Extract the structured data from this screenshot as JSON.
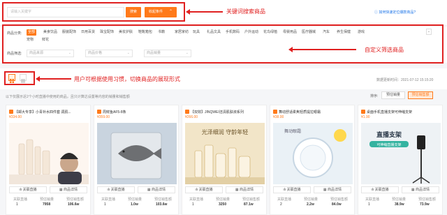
{
  "search": {
    "placeholder": "请输入关键字",
    "search_label": "搜索",
    "collapse_label": "收起条件",
    "help_link": "如何快速定位爆款商品?"
  },
  "annotations": {
    "search": "关键词搜索商品",
    "filter": "自定义筛选商品",
    "view": "用户可根据使用习惯，切换商品的展现形式"
  },
  "filters": {
    "category_label": "商品分类:",
    "categories": [
      "全部",
      "美食饮品",
      "服装配饰",
      "日用百货",
      "珠宝配饰",
      "美妆护肤",
      "鞋靴箱包",
      "书籍",
      "家居家纺",
      "玩具",
      "礼品文具",
      "手机数码",
      "户外运动",
      "花鸟绿植",
      "母婴用品",
      "医疗器械",
      "汽车",
      "养生保健",
      "游戏",
      "宠物",
      "鲜花"
    ],
    "sort_label": "商品筛选:",
    "selects": [
      "商品来源",
      "商品价格",
      "商品销量"
    ]
  },
  "view": {
    "timestamp": "数据更新时间：2021-07-12 15:15:20",
    "tip": "以下仅展示近2个小时直播中使用的商品，且只计算达设置等内容的销量和销售额",
    "sort_label": "排序:",
    "sort_options": [
      "预估销量",
      "预估销售额"
    ]
  },
  "products": [
    {
      "title": "【邮大专享】小青补水四件套 调肌...",
      "price": "¥334.00",
      "btn_live": "关联直播",
      "btn_detail": "商品详情",
      "live": "1",
      "sales": "7958",
      "revenue": "106.6w",
      "img_color": "#fdf6f0"
    },
    {
      "title": "周鲜鱼AF5-8条",
      "price": "¥359.00",
      "btn_live": "关联直播",
      "btn_detail": "商品详情",
      "live": "1",
      "sales": "1.0w",
      "revenue": "103.6w",
      "img_color": "#d9e3ee"
    },
    {
      "title": "【双效】JINQWEI洁清肌肤液系列",
      "price": "¥266.00",
      "btn_live": "关联直播",
      "btn_detail": "商品详情",
      "live": "1",
      "sales": "3250",
      "revenue": "87.1w",
      "img_color": "#f3e9d2"
    },
    {
      "title": "舞动舒适柔焦轻质提拉眼霜",
      "price": "¥38.00",
      "btn_live": "关联直播",
      "btn_detail": "商品详情",
      "live": "2",
      "sales": "2.2w",
      "revenue": "84.0w",
      "img_color": "#e8f1f6"
    },
    {
      "title": "桌面手机直播支架可伸缩支架",
      "price": "¥1.90",
      "btn_live": "关联直播",
      "btn_detail": "商品详情",
      "live": "1",
      "sales": "38.9w",
      "revenue": "73.9w",
      "img_color": "#eef2f5"
    }
  ],
  "stat_labels": {
    "live": "关联直播",
    "sales": "预估销量",
    "revenue": "预估销售额"
  },
  "img_texts": {
    "p3_slogan": "光泽细润 守龄年轻",
    "p4_text": "舞动眼霜",
    "p5_text": "直播支架",
    "p5_sub": "可伸缩直播支架"
  },
  "colors": {
    "accent": "#ff7a1a",
    "annotation_red": "#e02020"
  }
}
